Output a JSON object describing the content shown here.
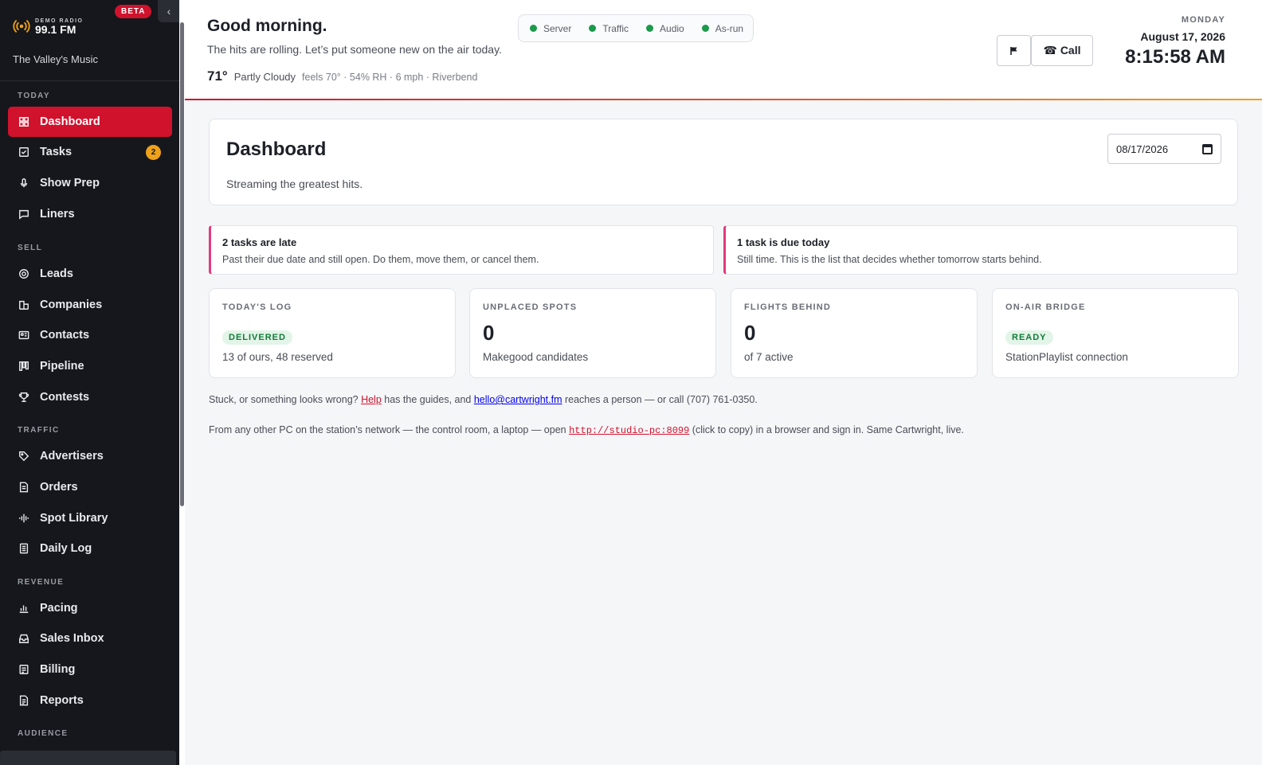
{
  "brand": {
    "demo": "DEMO RADIO",
    "freq": "99.1 FM",
    "beta": "BETA",
    "tagline": "The Valley's Music"
  },
  "sidebar": {
    "sections": {
      "today": "TODAY",
      "sell": "SELL",
      "traffic": "TRAFFIC",
      "revenue": "REVENUE",
      "audience": "AUDIENCE"
    },
    "items": {
      "dashboard": "Dashboard",
      "tasks": "Tasks",
      "tasks_badge": "2",
      "show_prep": "Show Prep",
      "liners": "Liners",
      "leads": "Leads",
      "companies": "Companies",
      "contacts": "Contacts",
      "pipeline": "Pipeline",
      "contests": "Contests",
      "advertisers": "Advertisers",
      "orders": "Orders",
      "spot_library": "Spot Library",
      "daily_log": "Daily Log",
      "pacing": "Pacing",
      "sales_inbox": "Sales Inbox",
      "billing": "Billing",
      "reports": "Reports"
    }
  },
  "header": {
    "greeting": "Good morning.",
    "subtitle": "The hits are rolling. Let’s put someone new on the air today.",
    "weather": {
      "temp": "71°",
      "condition": "Partly Cloudy",
      "detail": "feels 70° · 54% RH · 6 mph · Riverbend"
    },
    "status": {
      "server": "Server",
      "traffic": "Traffic",
      "audio": "Audio",
      "asrun": "As-run"
    },
    "call_label": "☎ Call",
    "day": "MONDAY",
    "date": "August 17, 2026",
    "time": "8:15:58 AM"
  },
  "page": {
    "title": "Dashboard",
    "subtitle": "Streaming the greatest hits.",
    "date_value": "08/17/2026"
  },
  "alerts": {
    "late": {
      "title": "2 tasks are late",
      "text": "Past their due date and still open. Do them, move them, or cancel them."
    },
    "today": {
      "title": "1 task is due today",
      "text": "Still time. This is the list that decides whether tomorrow starts behind."
    }
  },
  "stats": {
    "log": {
      "label": "TODAY'S LOG",
      "tag": "DELIVERED",
      "desc": "13 of ours, 48 reserved"
    },
    "unplaced": {
      "label": "UNPLACED SPOTS",
      "value": "0",
      "desc": "Makegood candidates"
    },
    "flights": {
      "label": "FLIGHTS BEHIND",
      "value": "0",
      "desc": "of 7 active"
    },
    "bridge": {
      "label": "ON-AIR BRIDGE",
      "tag": "READY",
      "desc": "StationPlaylist connection"
    }
  },
  "footer": {
    "help_pre": "Stuck, or something looks wrong? ",
    "help_link": "Help",
    "help_mid": " has the guides, and ",
    "email": "hello@cartwright.fm",
    "help_post": " reaches a person — or call (707) 761-0350.",
    "net_pre": "From any other PC on the station’s network — the control room, a laptop — open ",
    "net_url": "http://studio-pc:8099",
    "net_post": " (click to copy) in a browser and sign in. Same Cartwright, live."
  },
  "colors": {
    "accent": "#d0122d",
    "sidebar_bg": "#15171c",
    "ok": "#1a9a4a",
    "badge": "#f0a11a",
    "alert_border": "#e23a7c"
  }
}
